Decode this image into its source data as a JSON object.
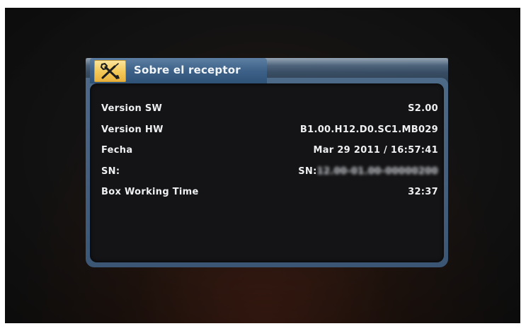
{
  "dialog": {
    "title": "Sobre el receptor",
    "icon": "wrench-screwdriver-icon"
  },
  "info": [
    {
      "label": "Version SW",
      "value": "S2.00"
    },
    {
      "label": "Version HW",
      "value": "B1.00.H12.D0.SC1.MB029"
    },
    {
      "label": "Fecha",
      "value": "Mar 29 2011 / 16:57:41"
    },
    {
      "label": "SN:",
      "value_prefix": "SN:",
      "value_blurred": "12.00-01.00-00000200"
    },
    {
      "label": "Box Working Time",
      "value": "32:37"
    }
  ],
  "colors": {
    "frame": "#4d6a88",
    "title_tab": "#3d6188",
    "icon_box": "#f3c857",
    "panel": "#141416",
    "text": "#eef0f2"
  }
}
